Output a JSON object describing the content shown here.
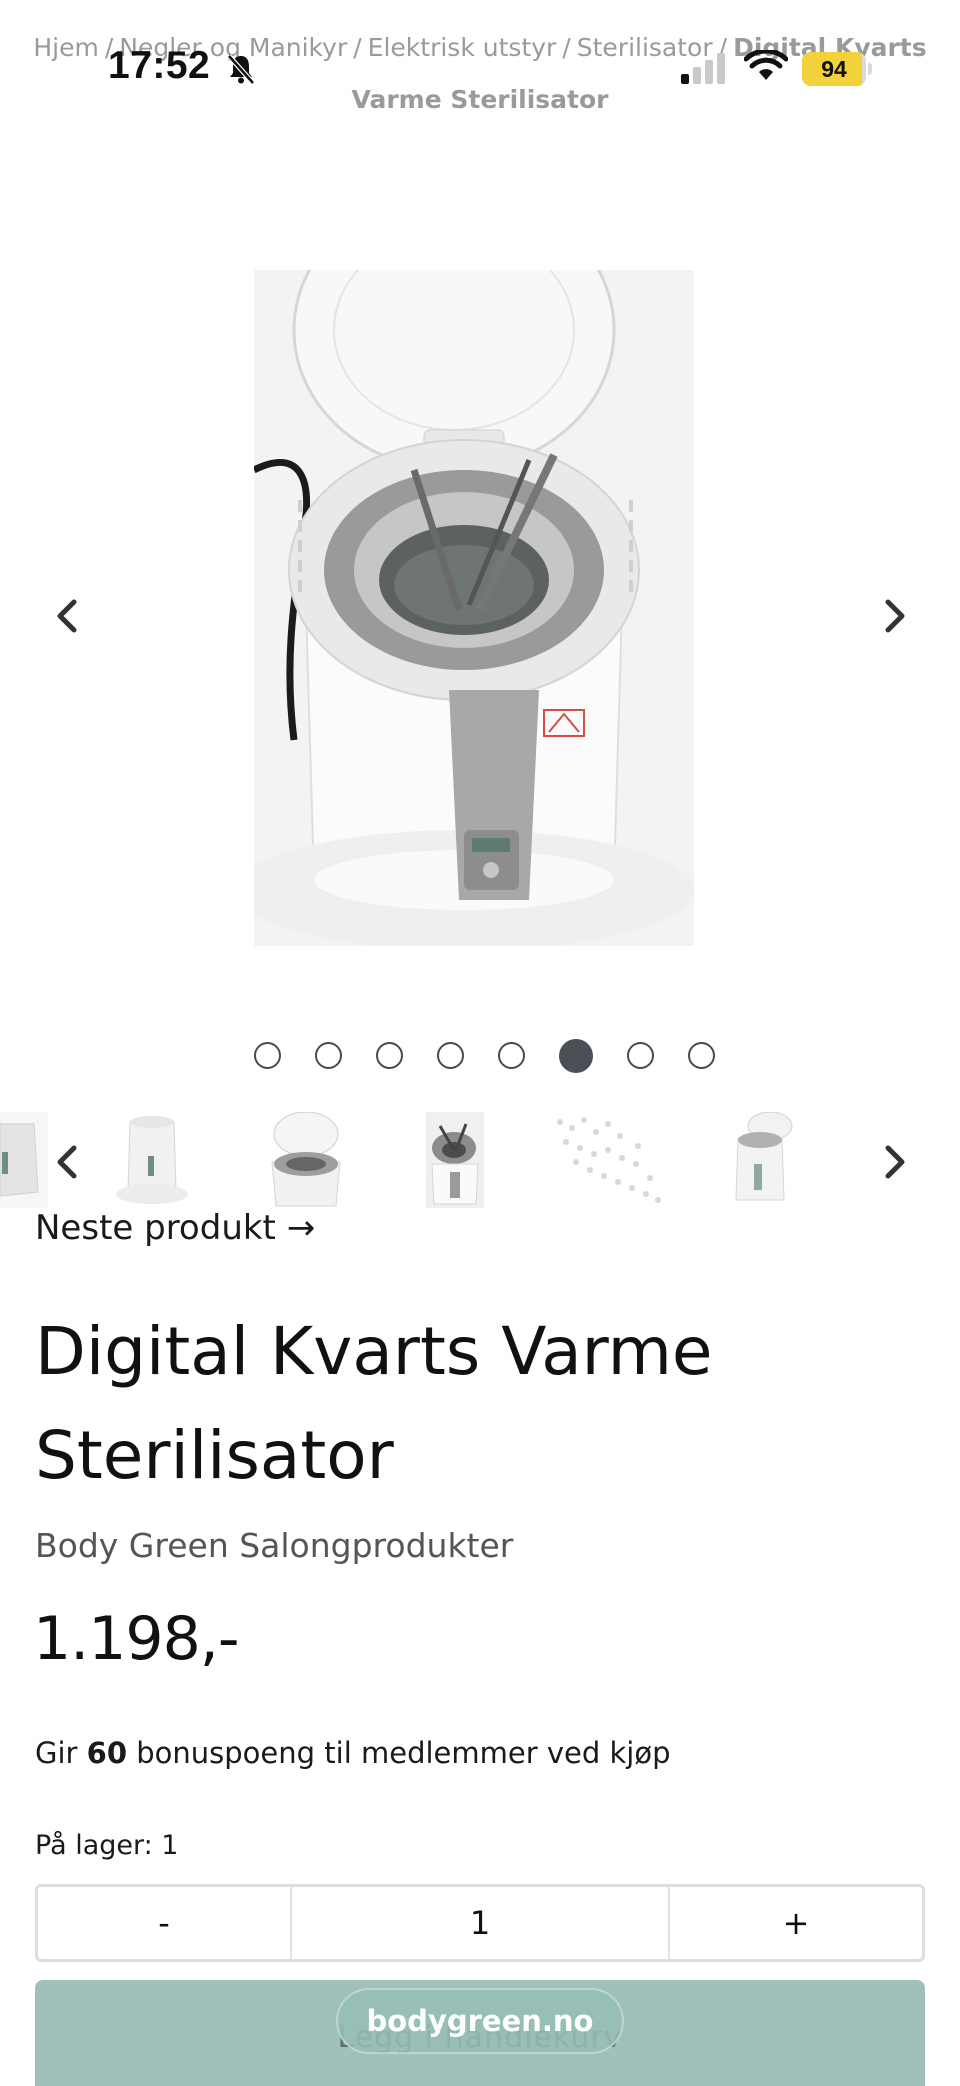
{
  "status_bar": {
    "time": "17:52",
    "battery_percent": 94,
    "battery_label": "94"
  },
  "breadcrumb": {
    "items": [
      "Hjem",
      "Negler og Manikyr",
      "Elektrisk utstyr",
      "Sterilisator"
    ],
    "current": "Digital Kvarts Varme Sterilisator"
  },
  "gallery": {
    "dot_count": 8,
    "active_index": 5
  },
  "product": {
    "next_link": "Neste produkt →",
    "title": "Digital Kvarts Varme Sterilisator",
    "brand": "Body Green Salongprodukter",
    "price": "1.198,-",
    "bonus_prefix": "Gir ",
    "bonus_points": "60",
    "bonus_suffix": " bonuspoeng til medlemmer ved kjøp",
    "stock": "På lager: 1"
  },
  "quantity": {
    "minus": "-",
    "value": "1",
    "plus": "+"
  },
  "cart": {
    "label": "Legg i handlekurv"
  },
  "browser": {
    "url": "bodygreen.no"
  },
  "colors": {
    "cart_button": "#a0c1b9",
    "active_dot": "#4c4f55",
    "battery_fill": "#f2d13a"
  }
}
